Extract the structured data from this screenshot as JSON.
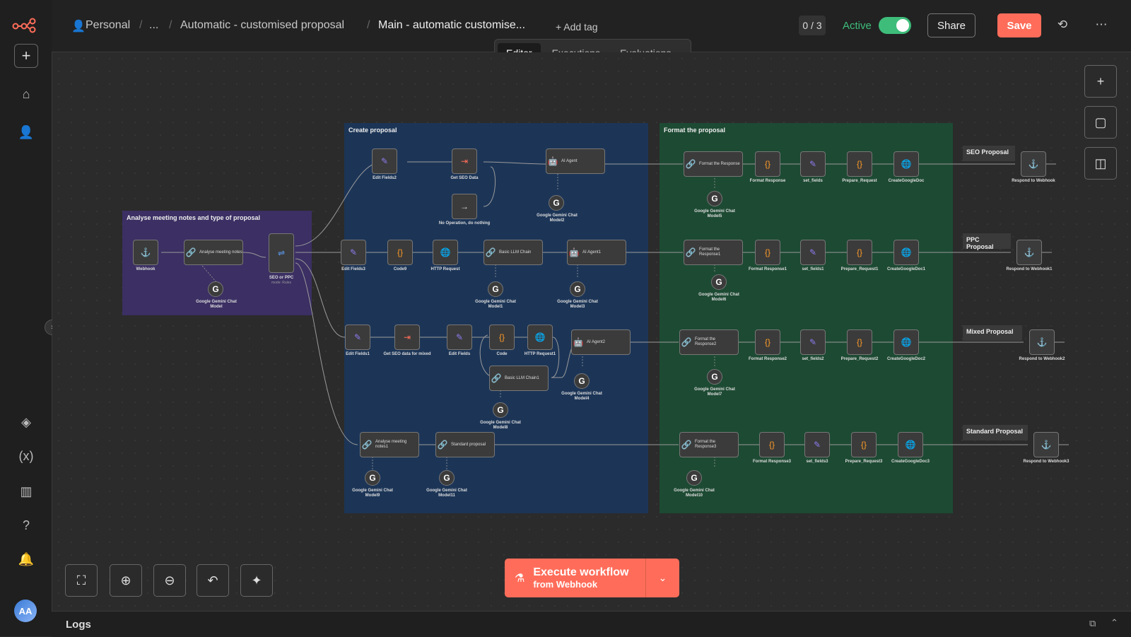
{
  "breadcrumb": {
    "project": "Personal",
    "ellipsis": "...",
    "folder": "Automatic - customised proposal",
    "workflow": "Main - automatic customise...",
    "add_tag": "+ Add tag"
  },
  "header": {
    "counter": "0 / 3",
    "active_label": "Active",
    "share": "Share",
    "save": "Save"
  },
  "tabs": [
    "Editor",
    "Executions",
    "Evaluations"
  ],
  "groups": {
    "analyse": "Analyse meeting notes and type of proposal",
    "create": "Create proposal",
    "format": "Format the proposal"
  },
  "stickies": {
    "seo": "SEO Proposal",
    "ppc": "PPC Proposal",
    "mixed": "Mixed Proposal",
    "standard": "Standard Proposal"
  },
  "nodes": {
    "webhook": "Webhook",
    "analyse_notes": "Analyse meeting notes",
    "seo_or_ppc": "SEO or PPC",
    "seo_or_ppc_sub": "mode: Rules",
    "gemini": "Google Gemini Chat Model",
    "edit_fields2": "Edit Fields2",
    "get_seo_data": "Get SEO Data",
    "no_op": "No Operation, do nothing",
    "ai_agent": "AI Agent",
    "gemini2": "Google Gemini Chat Model2",
    "edit_fields3": "Edit Fields3",
    "code9": "Code9",
    "http_request": "HTTP Request",
    "basic_llm_chain": "Basic LLM Chain",
    "ai_agent1": "AI Agent1",
    "gemini1": "Google Gemini Chat Model1",
    "gemini3": "Google Gemini Chat Model3",
    "edit_fields1": "Edit Fields1",
    "get_seo_mixed": "Get SEO data for mixed",
    "edit_fields": "Edit Fields",
    "code": "Code",
    "http_request1": "HTTP Request1",
    "ai_agent2": "AI Agent2",
    "basic_llm_chain1": "Basic LLM Chain1",
    "gemini4": "Google Gemini Chat Model4",
    "gemini8": "Google Gemini Chat Model8",
    "analyse_notes1": "Analyse meeting notes1",
    "standard_proposal": "Standard proposal",
    "gemini9": "Google Gemini Chat Model9",
    "gemini11": "Google Gemini Chat Model11",
    "format_response": "Format the Response",
    "format_response1": "Format the Response1",
    "format_response2": "Format the Response2",
    "format_response3": "Format the Response3",
    "gemini5": "Google Gemini Chat Model5",
    "gemini6": "Google Gemini Chat Model6",
    "gemini7": "Google Gemini Chat Model7",
    "gemini10": "Google Gemini Chat Model10",
    "fmt_resp": "Format Response",
    "fmt_resp1": "Format Response1",
    "fmt_resp2": "Format Response2",
    "fmt_resp3": "Format Response3",
    "set_fields": "set_fields",
    "set_fields1": "set_fields1",
    "set_fields2": "set_fields2",
    "set_fields3": "set_fields3",
    "prep": "Prepare_Request",
    "prep1": "Prepare_Request1",
    "prep2": "Prepare_Request2",
    "prep3": "Prepare_Request3",
    "gdoc": "CreateGoogleDoc",
    "gdoc1": "CreateGoogleDoc1",
    "gdoc2": "CreateGoogleDoc2",
    "gdoc3": "CreateGoogleDoc3",
    "respond": "Respond to Webhook",
    "respond1": "Respond to Webhook1",
    "respond2": "Respond to Webhook2",
    "respond3": "Respond to Webhook3"
  },
  "execute": {
    "line1": "Execute workflow",
    "line2": "from Webhook"
  },
  "logs": "Logs",
  "avatar": "AA",
  "colors": {
    "accent": "#ff6d5a",
    "active": "#3ebd7a",
    "group_analyse": "#3b2f63",
    "group_create": "#1c3557",
    "group_format": "#1d4a33"
  }
}
